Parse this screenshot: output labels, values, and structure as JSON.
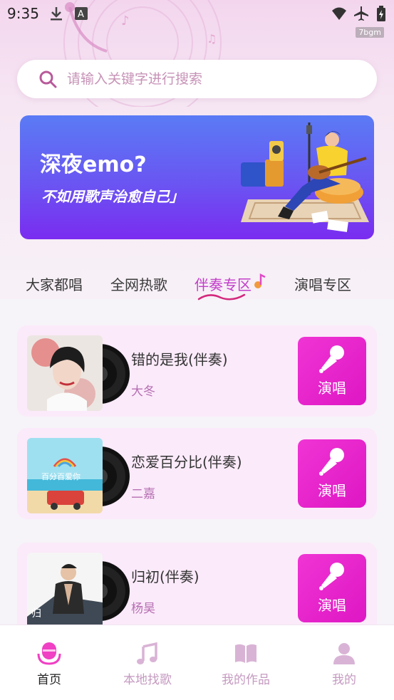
{
  "status_bar": {
    "time": "9:35",
    "watermark": "7bgm"
  },
  "search": {
    "placeholder": "请输入关键字进行搜索"
  },
  "banner": {
    "title": "深夜emo?",
    "subtitle": "不如用歌声治愈自己」"
  },
  "tabs": [
    {
      "label": "大家都唱",
      "active": false
    },
    {
      "label": "全网热歌",
      "active": false
    },
    {
      "label": "伴奏专区",
      "active": true
    },
    {
      "label": "演唱专区",
      "active": false
    }
  ],
  "songs": [
    {
      "title": "错的是我(伴奏)",
      "artist": "大冬",
      "button": "演唱"
    },
    {
      "title": "恋爱百分比(伴奏)",
      "artist": "二嘉",
      "button": "演唱"
    },
    {
      "title": "归初(伴奏)",
      "artist": "杨昊",
      "button": "演唱"
    }
  ],
  "bottom_nav": [
    {
      "label": "首页",
      "icon": "microphone-icon",
      "active": true
    },
    {
      "label": "本地找歌",
      "icon": "music-note-icon",
      "active": false
    },
    {
      "label": "我的作品",
      "icon": "book-icon",
      "active": false
    },
    {
      "label": "我的",
      "icon": "user-icon",
      "active": false
    }
  ],
  "colors": {
    "accent": "#e21cc8",
    "active_tab": "#c23ec9",
    "artist": "#b66fb2",
    "card_bg": "#fbeafa",
    "banner_start": "#5a7bf5",
    "banner_end": "#7a2cf0"
  }
}
